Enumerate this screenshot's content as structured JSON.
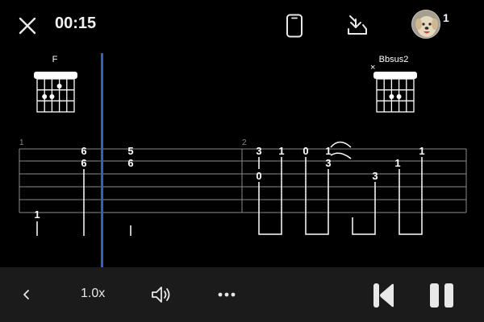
{
  "topbar": {
    "close_icon": "close-icon",
    "time": "00:15",
    "phone_icon": "phone-icon",
    "download_icon": "download-icon",
    "avatar_icon": "avatar-icon",
    "participant_count": "1"
  },
  "chords": [
    {
      "name": "F",
      "mute_mark": ""
    },
    {
      "name": "Bbsus2",
      "mute_mark": "×"
    }
  ],
  "measures": [
    "1",
    "2"
  ],
  "tab_notes": {
    "m1": [
      "1",
      "6",
      "6",
      "5",
      "6"
    ],
    "m2": [
      "3",
      "0",
      "1",
      "0",
      "1",
      "3",
      "1",
      "3",
      "1",
      "1"
    ]
  },
  "bottombar": {
    "back_icon": "chevron-left-icon",
    "speed": "1.0x",
    "volume_icon": "speaker-icon",
    "more_icon": "more-horizontal-icon",
    "skip_back_icon": "skip-back-icon",
    "pause_icon": "pause-icon"
  },
  "colors": {
    "background": "#000000",
    "playhead": "#3a5cc8",
    "bottom_bar": "#1b1b1b",
    "staff_lines": "#8a8a8a"
  }
}
